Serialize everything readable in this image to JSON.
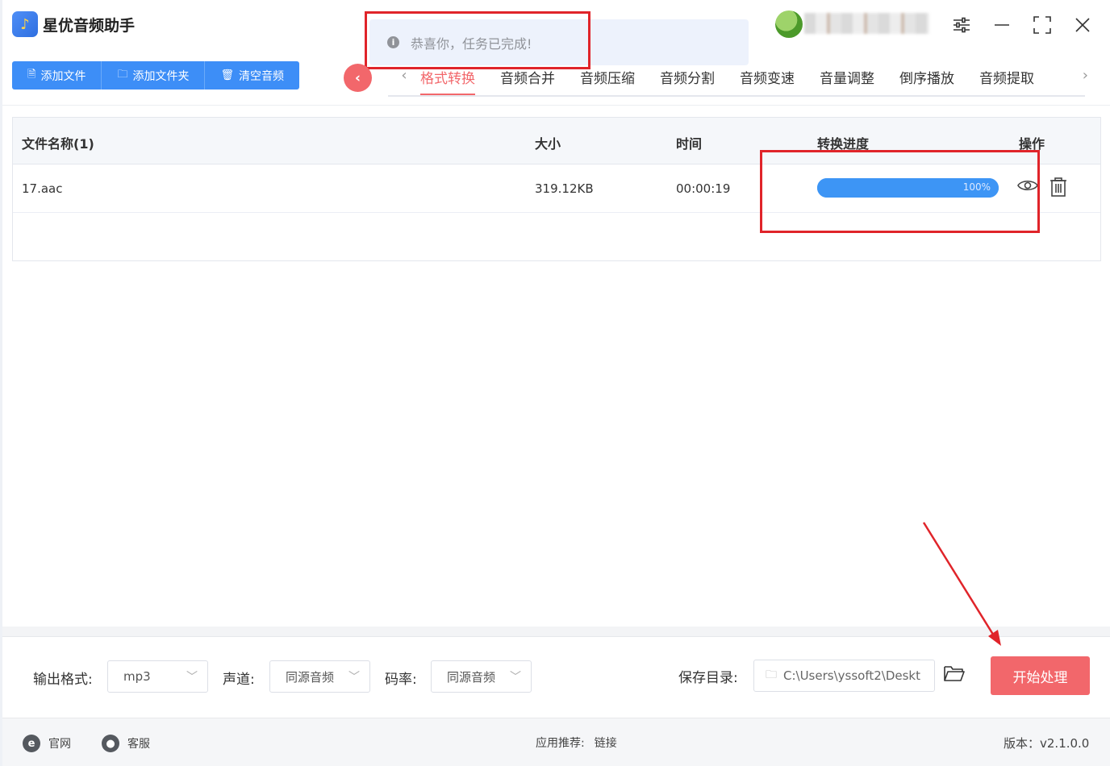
{
  "app": {
    "title": "星优音频助手"
  },
  "toast": {
    "icon": "info-icon",
    "message": "恭喜你，任务已完成!"
  },
  "window_controls": {
    "settings": "sliders-icon",
    "minimize": "minimize-icon",
    "maximize": "maximize-icon",
    "close": "close-icon"
  },
  "toolbar": {
    "add_file": "添加文件",
    "add_folder": "添加文件夹",
    "clear_audio": "清空音频"
  },
  "tabs": [
    {
      "label": "格式转换",
      "active": true
    },
    {
      "label": "音频合并"
    },
    {
      "label": "音频压缩"
    },
    {
      "label": "音频分割"
    },
    {
      "label": "音频变速"
    },
    {
      "label": "音量调整"
    },
    {
      "label": "倒序播放"
    },
    {
      "label": "音频提取"
    }
  ],
  "table": {
    "headers": {
      "name": "文件名称(1)",
      "size": "大小",
      "time": "时间",
      "progress": "转换进度",
      "actions": "操作"
    },
    "rows": [
      {
        "name": "17.aac",
        "size": "319.12KB",
        "time": "00:00:19",
        "progress_pct": 100,
        "progress_label": "100%"
      }
    ]
  },
  "bottom": {
    "format_label": "输出格式:",
    "format_value": "mp3",
    "channel_label": "声道:",
    "channel_value": "同源音频",
    "bitrate_label": "码率:",
    "bitrate_value": "同源音频",
    "save_label": "保存目录:",
    "save_path": "C:\\Users\\yssoft2\\Deskt",
    "start_button": "开始处理"
  },
  "footer": {
    "website": "官网",
    "service": "客服",
    "recommend_label": "应用推荐:",
    "recommend_link": "链接",
    "version": "版本：v2.1.0.0"
  },
  "colors": {
    "accent_blue": "#3d8ef7",
    "accent_red": "#f2676b",
    "highlight_red": "#e0242a"
  }
}
